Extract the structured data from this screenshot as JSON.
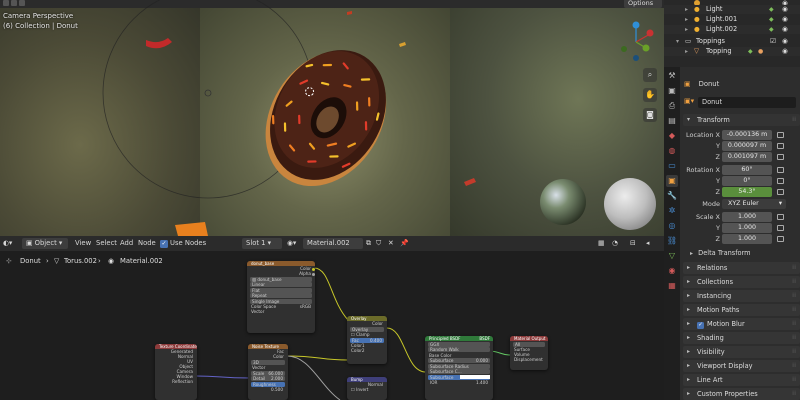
{
  "viewport": {
    "camera_label": "Camera Perspective",
    "collection_label": "(6) Collection | Donut",
    "options_label": "Options"
  },
  "node_editor": {
    "header": {
      "mode": "Object",
      "menu": [
        "View",
        "Select",
        "Add",
        "Node"
      ],
      "use_nodes_label": "Use Nodes",
      "slot": "Slot 1",
      "material": "Material.002"
    },
    "breadcrumb": [
      "Donut",
      "Torus.002",
      "Material.002"
    ],
    "nodes": {
      "image_texture": {
        "title": "donut_base",
        "outputs": [
          "Color",
          "Alpha"
        ],
        "image": "donut_base",
        "options": [
          "Linear",
          "Flat",
          "Repeat",
          "Single Image"
        ],
        "color_space_label": "Color Space",
        "color_space": "sRGB",
        "input": "Vector"
      },
      "tex_coord": {
        "title": "Texture Coordinate",
        "outputs": [
          "Generated",
          "Normal",
          "UV",
          "Object",
          "Camera",
          "Window",
          "Reflection"
        ]
      },
      "noise": {
        "title": "Noise Texture",
        "outputs": [
          "Fac",
          "Color"
        ],
        "dim": "3D",
        "input": "Vector",
        "fields": [
          {
            "label": "Scale",
            "value": "66.000"
          },
          {
            "label": "Detail",
            "value": "2.000"
          },
          {
            "label": "Roughness",
            "value": "0.500"
          }
        ]
      },
      "overlay": {
        "title": "Overlay",
        "output": "Color",
        "blend": "Overlay",
        "clamp": "Clamp",
        "fac_label": "Fac",
        "fac_value": "0.400",
        "inputs": [
          "Color1",
          "Color2"
        ]
      },
      "bump": {
        "title": "Bump",
        "output": "Normal",
        "invert": "Invert"
      },
      "principled": {
        "title": "Principled BSDF",
        "output": "BSDF",
        "dist": "GGX",
        "sss": "Random Walk",
        "inputs": [
          "Base Color",
          "Subsurface",
          "Subsurface Radius",
          "Subsurface C...",
          "Subsurface IOR"
        ],
        "values": [
          "",
          "0.000",
          "",
          "",
          "1.400"
        ]
      },
      "output": {
        "title": "Material Output",
        "target": "All",
        "inputs": [
          "Surface",
          "Volume",
          "Displacement"
        ]
      }
    }
  },
  "outliner": {
    "rows": [
      {
        "label": "Light",
        "icon": "light-icon"
      },
      {
        "label": "Light.001",
        "icon": "light-icon"
      },
      {
        "label": "Light.002",
        "icon": "light-icon"
      },
      {
        "label": "Toppings",
        "icon": "collection-icon"
      },
      {
        "label": "Topping",
        "icon": "mesh-icon"
      }
    ]
  },
  "properties": {
    "object_name": "Donut",
    "object_name_field": "Donut",
    "transform": {
      "title": "Transform",
      "location": {
        "label": "Location X",
        "x": "-0.000136 m",
        "y": "0.000097 m",
        "z": "0.001097 m"
      },
      "rotation": {
        "label": "Rotation X",
        "x": "60°",
        "y": "0°",
        "z": "54.3°"
      },
      "mode_label": "Mode",
      "mode": "XYZ Euler",
      "scale": {
        "label": "Scale X",
        "x": "1.000",
        "y": "1.000",
        "z": "1.000"
      },
      "axis_y": "Y",
      "axis_z": "Z",
      "delta": "Delta Transform"
    },
    "panels": [
      "Relations",
      "Collections",
      "Instancing",
      "Motion Paths",
      "Motion Blur",
      "Shading",
      "Visibility",
      "Viewport Display",
      "Line Art",
      "Custom Properties"
    ]
  },
  "colors": {
    "accent": "#4772b3",
    "green_field": "#5a8f3c",
    "panel_bg": "#2d2d2d"
  }
}
